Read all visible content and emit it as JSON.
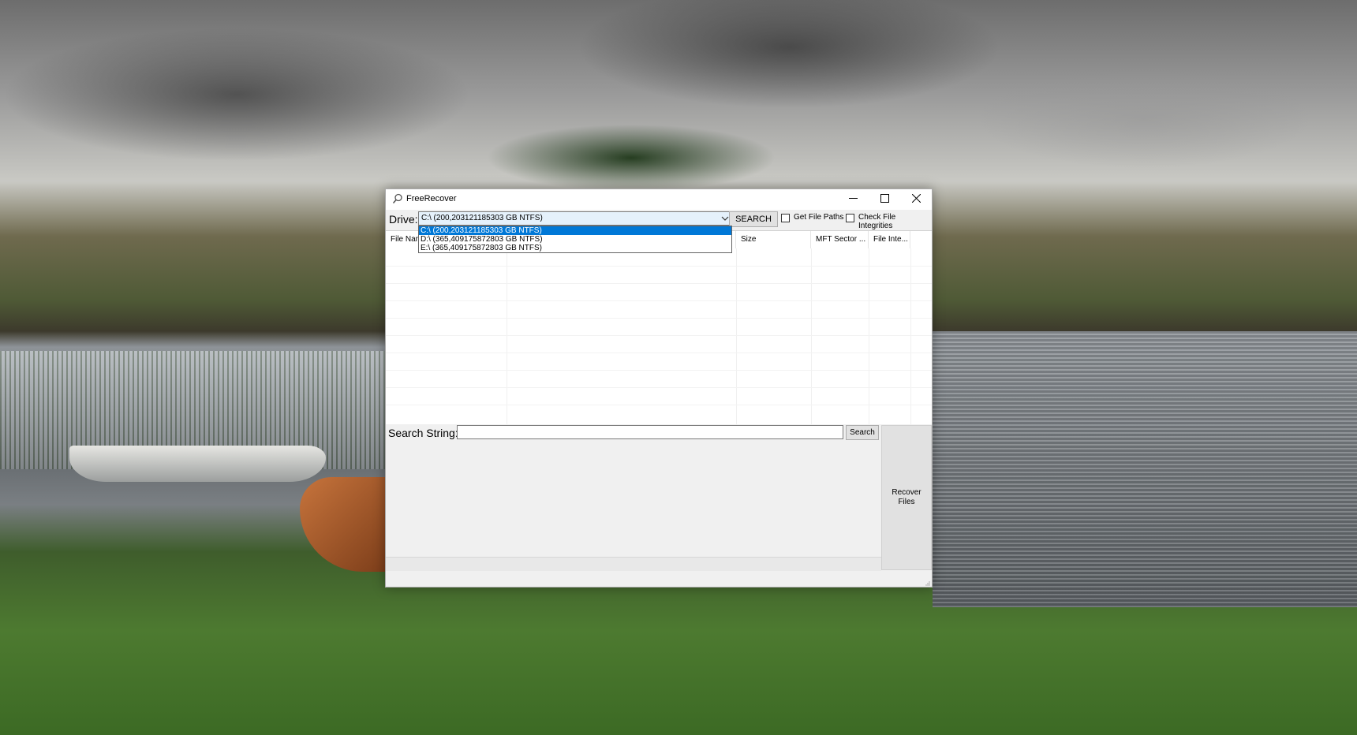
{
  "window": {
    "title": "FreeRecover",
    "icon": "search-icon",
    "controls": [
      "minimize-icon",
      "maximize-icon",
      "close-icon"
    ]
  },
  "drive": {
    "label": "Drive:",
    "selected": "C:\\ (200,203121185303 GB NTFS)",
    "options": [
      "C:\\ (200,203121185303 GB NTFS)",
      "D:\\ (365,409175872803 GB NTFS)",
      "E:\\ (365,409175872803 GB NTFS)"
    ],
    "highlighted_index": 0
  },
  "toolbar": {
    "search_button": "SEARCH",
    "get_file_paths": "Get File Paths",
    "check_file_integrities": "Check File Integrities"
  },
  "grid": {
    "columns": [
      "File Nam",
      "",
      "Size",
      "MFT Sector ...",
      "File Inte..."
    ]
  },
  "search": {
    "label": "Search String:",
    "value": "",
    "button": "Search"
  },
  "recover": {
    "line1": "Recover",
    "line2": "Files"
  }
}
